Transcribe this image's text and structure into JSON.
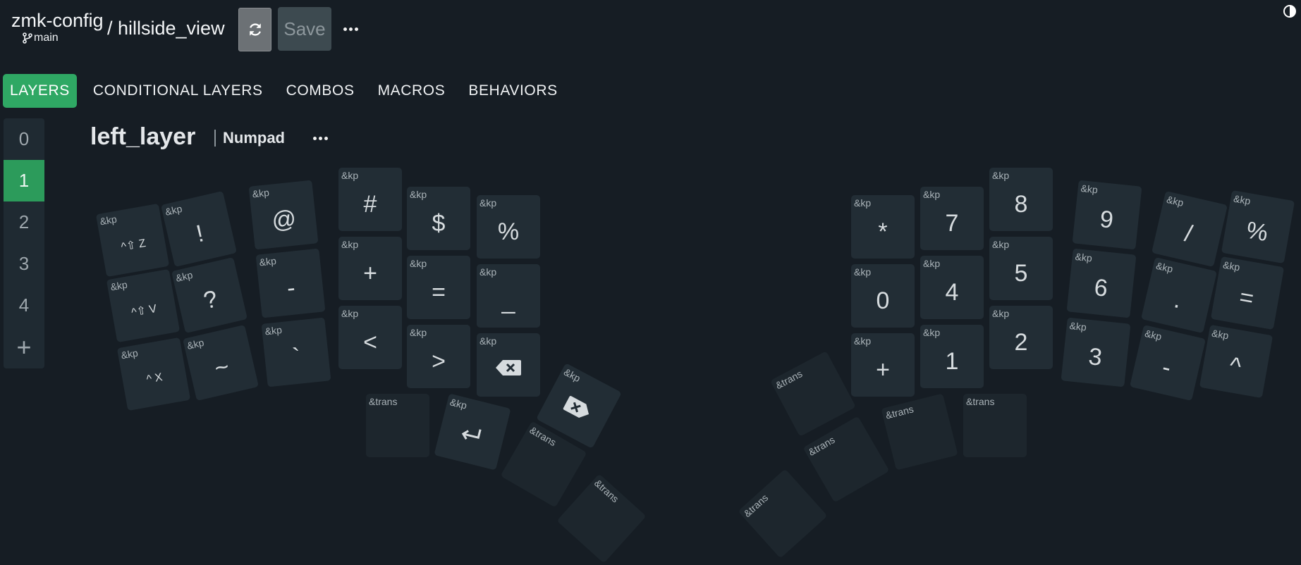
{
  "header": {
    "repo": "zmk-config",
    "branch": "main",
    "keyboard": "/ hillside_view",
    "save_label": "Save"
  },
  "tabs": [
    "LAYERS",
    "CONDITIONAL LAYERS",
    "COMBOS",
    "MACROS",
    "BEHAVIORS"
  ],
  "layers": [
    "0",
    "1",
    "2",
    "3",
    "4"
  ],
  "add_layer_label": "+",
  "layer": {
    "name": "left_layer",
    "tag": "Numpad"
  },
  "keys": [
    {
      "id": "L1",
      "beh": "&kp",
      "label": "^⇧ Z"
    },
    {
      "id": "L2",
      "beh": "&kp",
      "label": "!"
    },
    {
      "id": "L3",
      "beh": "&kp",
      "label": "@"
    },
    {
      "id": "L4",
      "beh": "&kp",
      "label": "#"
    },
    {
      "id": "L5",
      "beh": "&kp",
      "label": "$"
    },
    {
      "id": "L6",
      "beh": "&kp",
      "label": "%"
    },
    {
      "id": "L7",
      "beh": "&kp",
      "label": "^⇧ V"
    },
    {
      "id": "L8",
      "beh": "&kp",
      "label": "?"
    },
    {
      "id": "L9",
      "beh": "&kp",
      "label": "-"
    },
    {
      "id": "L10",
      "beh": "&kp",
      "label": "+"
    },
    {
      "id": "L11",
      "beh": "&kp",
      "label": "="
    },
    {
      "id": "L12",
      "beh": "&kp",
      "label": "_"
    },
    {
      "id": "L13",
      "beh": "&kp",
      "label": "^ X"
    },
    {
      "id": "L14",
      "beh": "&kp",
      "label": "~"
    },
    {
      "id": "L15",
      "beh": "&kp",
      "label": "`"
    },
    {
      "id": "L16",
      "beh": "&kp",
      "label": "<"
    },
    {
      "id": "L17",
      "beh": "&kp",
      "label": ">"
    },
    {
      "id": "L18",
      "beh": "&kp",
      "label": "",
      "icon": "backspace-icon"
    },
    {
      "id": "LT1",
      "beh": "&trans",
      "label": ""
    },
    {
      "id": "LT2",
      "beh": "&kp",
      "label": "",
      "icon": "enter-icon"
    },
    {
      "id": "LT3",
      "beh": "&kp",
      "label": "",
      "icon": "delete-icon"
    },
    {
      "id": "LT4",
      "beh": "&trans",
      "label": ""
    },
    {
      "id": "LT5",
      "beh": "&trans",
      "label": ""
    },
    {
      "id": "R1",
      "beh": "&kp",
      "label": "*"
    },
    {
      "id": "R2",
      "beh": "&kp",
      "label": "7"
    },
    {
      "id": "R3",
      "beh": "&kp",
      "label": "8"
    },
    {
      "id": "R4",
      "beh": "&kp",
      "label": "9"
    },
    {
      "id": "R5",
      "beh": "&kp",
      "label": "/"
    },
    {
      "id": "R6",
      "beh": "&kp",
      "label": "%"
    },
    {
      "id": "R7",
      "beh": "&kp",
      "label": "0"
    },
    {
      "id": "R8",
      "beh": "&kp",
      "label": "4"
    },
    {
      "id": "R9",
      "beh": "&kp",
      "label": "5"
    },
    {
      "id": "R10",
      "beh": "&kp",
      "label": "6"
    },
    {
      "id": "R11",
      "beh": "&kp",
      "label": "."
    },
    {
      "id": "R12",
      "beh": "&kp",
      "label": "="
    },
    {
      "id": "R13",
      "beh": "&kp",
      "label": "+"
    },
    {
      "id": "R14",
      "beh": "&kp",
      "label": "1"
    },
    {
      "id": "R15",
      "beh": "&kp",
      "label": "2"
    },
    {
      "id": "R16",
      "beh": "&kp",
      "label": "3"
    },
    {
      "id": "R17",
      "beh": "&kp",
      "label": "-"
    },
    {
      "id": "R18",
      "beh": "&kp",
      "label": "^"
    },
    {
      "id": "RT1",
      "beh": "&trans",
      "label": ""
    },
    {
      "id": "RT2",
      "beh": "&trans",
      "label": ""
    },
    {
      "id": "RT3",
      "beh": "&trans",
      "label": ""
    },
    {
      "id": "RT4",
      "beh": "&trans",
      "label": ""
    },
    {
      "id": "RT5",
      "beh": "&trans",
      "label": ""
    }
  ]
}
